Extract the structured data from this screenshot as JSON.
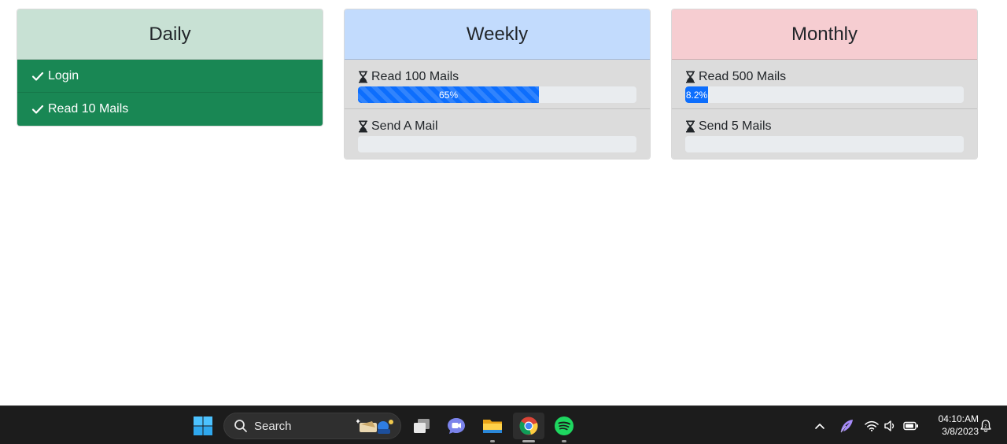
{
  "daily": {
    "title": "Daily",
    "tasks": [
      {
        "label": "Login",
        "status": "complete"
      },
      {
        "label": "Read 10 Mails",
        "status": "complete"
      }
    ]
  },
  "weekly": {
    "title": "Weekly",
    "tasks": [
      {
        "label": "Read 100 Mails",
        "progress_text": "65%",
        "progress": 0.65,
        "striped": true
      },
      {
        "label": "Send A Mail",
        "progress_text": "",
        "progress": 0
      }
    ]
  },
  "monthly": {
    "title": "Monthly",
    "tasks": [
      {
        "label": "Read 500 Mails",
        "progress_text": "8.2%",
        "progress": 0.082
      },
      {
        "label": "Send 5 Mails",
        "progress_text": "",
        "progress": 0
      }
    ]
  },
  "taskbar": {
    "search_label": "Search",
    "apps": [
      "start-icon",
      "search-icon",
      "task-view-icon",
      "teams-chat-icon",
      "file-explorer-icon",
      "chrome-icon",
      "spotify-icon"
    ],
    "tray_icons": [
      "chevron-up-icon",
      "feather-app-icon",
      "wifi-icon",
      "volume-icon",
      "battery-icon",
      "notification-icon"
    ],
    "time": "04:10:AM",
    "date": "3/8/2023"
  },
  "colors": {
    "daily_header": "#c8e1d4",
    "weekly_header": "#c2dbfd",
    "monthly_header": "#f6cdd1",
    "completed_task": "#198754",
    "pending_task": "#dcdcdc",
    "progress_fill": "#0d6efd",
    "taskbar": "#1c1c1c"
  }
}
